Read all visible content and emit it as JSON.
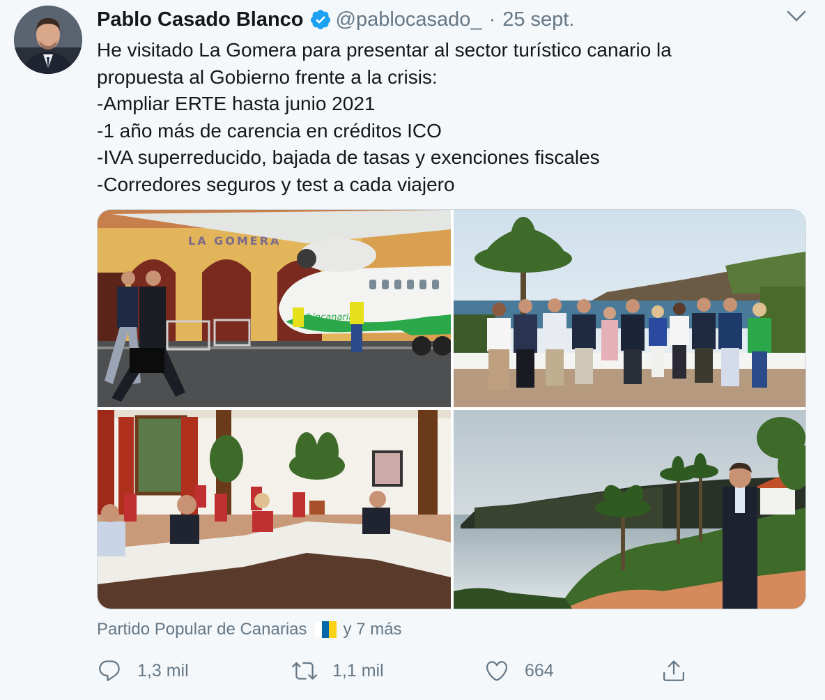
{
  "author": {
    "name": "Pablo Casado Blanco",
    "handle": "@pablocasado_",
    "separator": "·",
    "date": "25 sept."
  },
  "tweet_lines": [
    "He visitado La Gomera para presentar al sector turístico canario la",
    "propuesta al Gobierno frente a la crisis:",
    "-Ampliar ERTE hasta junio 2021",
    "-1 año más de carencia en créditos ICO",
    "-IVA superreducido, bajada de tasas y exenciones fiscales",
    "-Corredores seguros y test a cada viajero"
  ],
  "photo1_sign": "LA GOMERA",
  "photo1_plane_text": "bincanaria",
  "tagged": {
    "label": "Partido Popular de Canarias",
    "more": "y 7 más"
  },
  "actions": {
    "replies": "1,3 mil",
    "retweets": "1,1 mil",
    "likes": "664"
  },
  "colors": {
    "accent": "#1da1f2",
    "muted": "#657786",
    "background": "#f5f8fa"
  },
  "icons": [
    "verified-badge-icon",
    "chevron-down-icon",
    "reply-icon",
    "retweet-icon",
    "like-icon",
    "share-icon",
    "canary-flag-icon"
  ]
}
